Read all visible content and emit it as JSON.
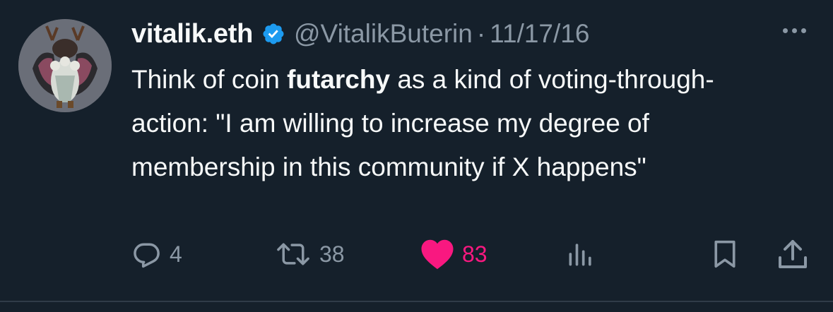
{
  "tweet": {
    "author_name": "vitalik.eth",
    "handle": "@VitalikButerin",
    "separator": "·",
    "date": "11/17/16",
    "text_before": "Think of coin ",
    "text_bold": "futarchy",
    "text_after": " as a kind of voting-through-action: \"I am willing to increase my degree of membership in this community if X happens\""
  },
  "actions": {
    "replies": "4",
    "retweets": "38",
    "likes": "83"
  },
  "colors": {
    "background": "#15202b",
    "text": "#f7f9f9",
    "muted": "#8b98a5",
    "verified": "#1d9bf0",
    "like": "#f91880"
  },
  "icons": [
    "reply-icon",
    "retweet-icon",
    "heart-icon",
    "views-icon",
    "bookmark-icon",
    "share-icon",
    "verified-badge-icon",
    "more-icon"
  ]
}
